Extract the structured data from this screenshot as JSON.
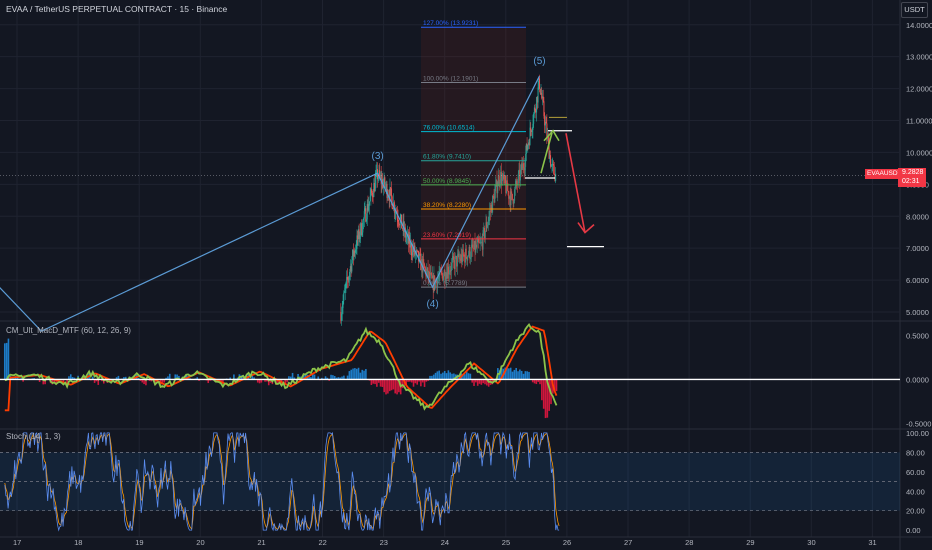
{
  "header": {
    "title": "EVAA / TetherUS PERPETUAL CONTRACT · 15 · Binance",
    "currency": "USDT"
  },
  "price_tag": {
    "ticker": "EVAAUSDT.P",
    "price": "9.2828",
    "countdown": "02:31"
  },
  "colors": {
    "background": "#131722",
    "grid": "#1f2330",
    "up": "#26a69a",
    "down": "#ef5350",
    "wave_line": "#5b9bd5",
    "price_red": "#f23645",
    "arrow_up": "#8bc34a",
    "arrow_down": "#e53945",
    "macd_line": "#8bc34a",
    "macd_signal": "#ff3d00",
    "stoch_k": "#5b8def",
    "stoch_d": "#ff9800"
  },
  "time_axis": [
    "17",
    "18",
    "19",
    "20",
    "21",
    "22",
    "23",
    "24",
    "25",
    "26",
    "27",
    "28",
    "29",
    "30",
    "31"
  ],
  "indicators": {
    "macd_label": "CM_Ult_MacD_MTF (60, 12, 26, 9)",
    "stoch_label": "Stoch (14, 1, 3)"
  },
  "chart_data": [
    {
      "type": "candlestick",
      "pane": "price",
      "y_axis_ticks": [
        "14.0000",
        "13.0000",
        "12.0000",
        "11.0000",
        "10.0000",
        "9.0000",
        "8.0000",
        "7.0000",
        "6.0000",
        "5.0000"
      ],
      "ylim": [
        4.75,
        14.4
      ],
      "elliott_wave": [
        {
          "label": "(3)",
          "day": 22.9,
          "price": 9.35
        },
        {
          "label": "(4)",
          "day": 23.8,
          "price": 5.78
        },
        {
          "label": "(5)",
          "day": 25.55,
          "price": 12.39
        }
      ],
      "wave_path": [
        {
          "day": 16.5,
          "price": 6.2
        },
        {
          "day": 17.4,
          "price": 4.4
        },
        {
          "day": 22.9,
          "price": 9.35
        },
        {
          "day": 23.8,
          "price": 5.78
        },
        {
          "day": 25.55,
          "price": 12.39
        }
      ],
      "fibonacci": [
        {
          "label": "127.00% (13.9231)",
          "price": 13.9231,
          "color": "#2962ff"
        },
        {
          "label": "100.00% (12.1901)",
          "price": 12.1901,
          "color": "#787b86"
        },
        {
          "label": "76.00% (10.6514)",
          "price": 10.6514,
          "color": "#00bcd4"
        },
        {
          "label": "61.80% (9.7410)",
          "price": 9.741,
          "color": "#26a69a"
        },
        {
          "label": "50.00% (8.9845)",
          "price": 8.9845,
          "color": "#4caf50"
        },
        {
          "label": "38.20% (8.2280)",
          "price": 8.228,
          "color": "#ff9800"
        },
        {
          "label": "23.60% (7.2919)",
          "price": 7.2919,
          "color": "#f23645"
        },
        {
          "label": "0.00% (5.7789)",
          "price": 5.7789,
          "color": "#787b86"
        }
      ],
      "projection": {
        "current_price": 9.2828,
        "bounce_target": 10.68,
        "drop_target": 7.05
      }
    },
    {
      "type": "line",
      "pane": "macd",
      "name": "CM_Ult_MacD_MTF (60, 12, 26, 9)",
      "y_axis_ticks": [
        "0.5000",
        "0.0000",
        "-0.5000"
      ],
      "ylim": [
        -0.55,
        0.65
      ]
    },
    {
      "type": "line",
      "pane": "stoch",
      "name": "Stoch (14, 1, 3)",
      "y_axis_ticks": [
        "100.00",
        "80.00",
        "60.00",
        "40.00",
        "20.00",
        "0.00"
      ],
      "ylim": [
        -5,
        103
      ],
      "bands": [
        20,
        50,
        80
      ]
    }
  ]
}
